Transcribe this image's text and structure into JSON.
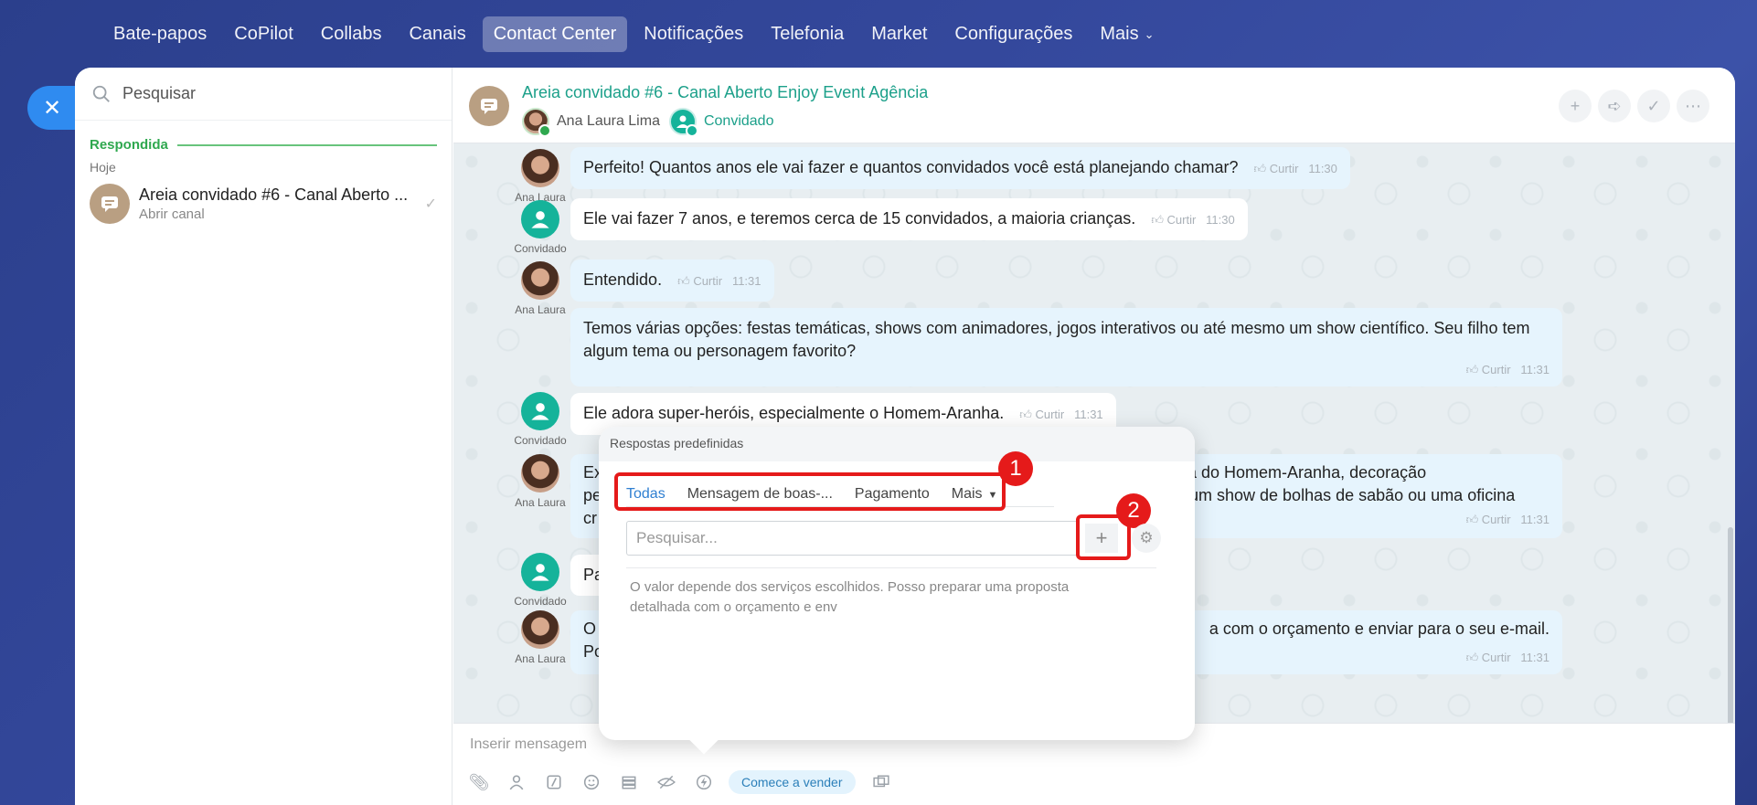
{
  "nav": {
    "items": [
      "Bate-papos",
      "CoPilot",
      "Collabs",
      "Canais",
      "Contact Center",
      "Notificações",
      "Telefonia",
      "Market",
      "Configurações",
      "Mais"
    ],
    "active": "Contact Center"
  },
  "sidebar": {
    "search_placeholder": "Pesquisar",
    "section": "Respondida",
    "today": "Hoje",
    "chat": {
      "title": "Areia convidado #6 - Canal Aberto ...",
      "subtitle": "Abrir canal"
    }
  },
  "conversation": {
    "title": "Areia convidado #6 - Canal Aberto Enjoy Event Agência",
    "members": [
      "Ana Laura Lima",
      "Convidado"
    ],
    "like_label": "Curtir",
    "messages": [
      {
        "author": "Ana Laura",
        "text": "Perfeito! Quantos anos ele vai fazer e quantos convidados você está planejando chamar?",
        "time": "11:30"
      },
      {
        "author": "Convidado",
        "text": "Ele vai fazer 7 anos, e teremos cerca de 15 convidados, a maioria crianças.",
        "time": "11:30"
      },
      {
        "author": "Ana Laura",
        "text": "Entendido.",
        "time": "11:31"
      },
      {
        "author": "",
        "text": "Temos várias opções: festas temáticas, shows com animadores, jogos interativos ou até mesmo um show científico. Seu filho tem algum tema ou personagem favorito?",
        "time": "11:31"
      },
      {
        "author": "Convidado",
        "text": "Ele adora super-heróis, especialmente o Homem-Aranha.",
        "time": "11:31"
      },
      {
        "author": "Ana Laura",
        "text_left": [
          "Ex",
          "pe",
          "cr"
        ],
        "text_right": [
          "ça do Homem-Aranha, decoração",
          "r um show de bolhas de sabão ou uma oficina"
        ],
        "time": "11:31"
      },
      {
        "author": "Convidado",
        "text": "Pa"
      },
      {
        "author": "Ana Laura",
        "text_left": [
          "O",
          "Po"
        ],
        "text_right": [
          "a com o orçamento e enviar para o seu e-mail."
        ],
        "time": "11:31"
      }
    ],
    "input_placeholder": "Inserir mensagem",
    "sell_button": "Comece a vender"
  },
  "popup": {
    "title": "Respostas predefinidas",
    "tabs": [
      "Todas",
      "Mensagem de boas-...",
      "Pagamento",
      "Mais"
    ],
    "active_tab": "Todas",
    "search_placeholder": "Pesquisar...",
    "reply_preview": "O valor depende dos serviços escolhidos. Posso preparar uma proposta detalhada com o orçamento e env",
    "callouts": [
      "1",
      "2"
    ]
  },
  "colors": {
    "accent": "#1ca08a",
    "highlight": "#e51a1a",
    "close_button": "#2f8bf0"
  }
}
